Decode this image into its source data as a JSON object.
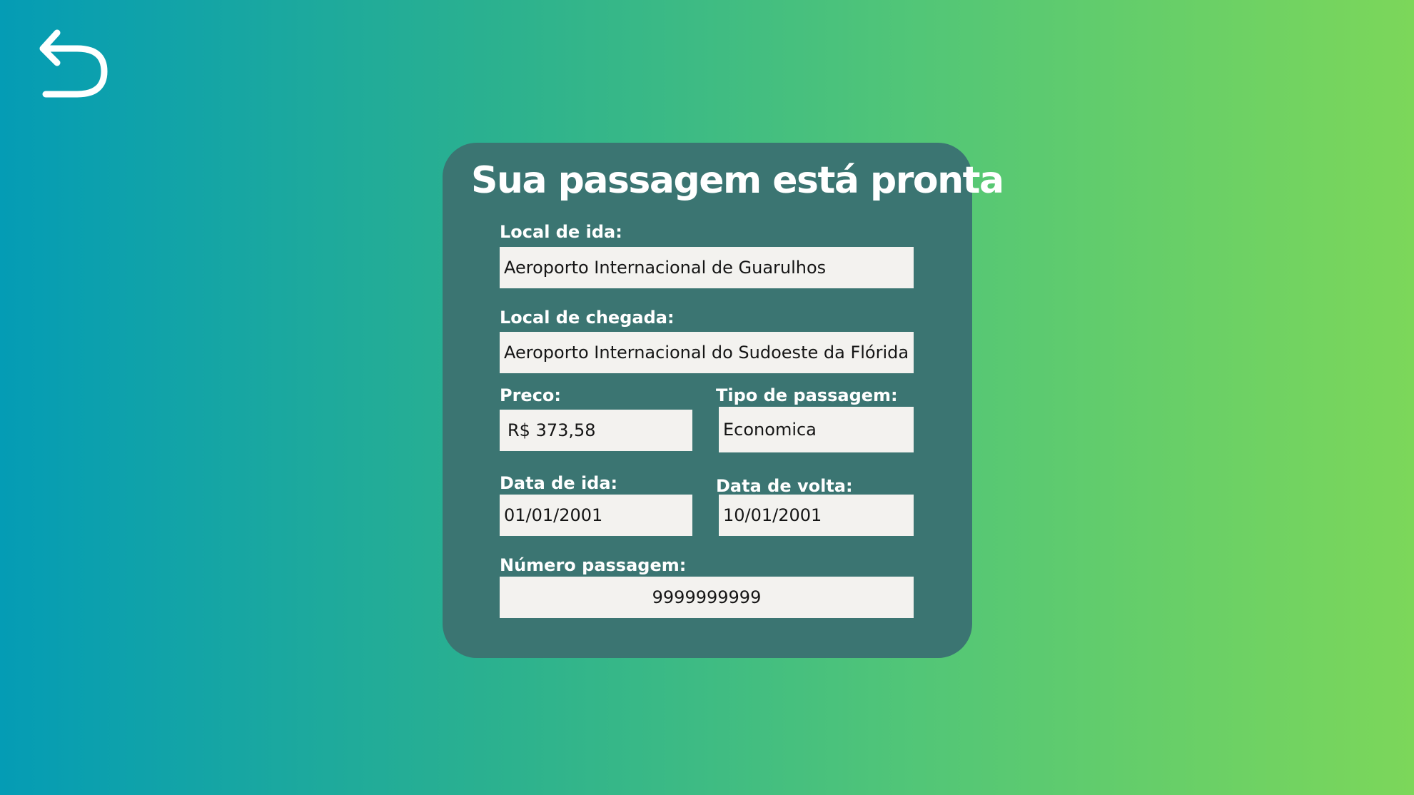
{
  "back_button": {
    "icon": "undo-arrow-icon",
    "color": "#ffffff"
  },
  "card": {
    "title": "Sua passagem está pronta",
    "background": "#3b7572"
  },
  "fields": {
    "origin": {
      "label": "Local de ida:",
      "value": "Aeroporto Internacional de Guarulhos"
    },
    "destination": {
      "label": "Local de chegada:",
      "value": "Aeroporto Internacional do Sudoeste da Flórida"
    },
    "price": {
      "label": "Preco:",
      "value": "R$ 373,58"
    },
    "ticket_type": {
      "label": "Tipo de passagem:",
      "value": "Economica"
    },
    "departure_date": {
      "label": "Data de ida:",
      "value": "01/01/2001"
    },
    "return_date": {
      "label": "Data de volta:",
      "value": "10/01/2001"
    },
    "ticket_number": {
      "label": "Número passagem:",
      "value": "9999999999"
    }
  },
  "colors": {
    "gradient_start": "#049cb5",
    "gradient_end": "#7cd75a",
    "field_background": "#f3f2ef"
  }
}
